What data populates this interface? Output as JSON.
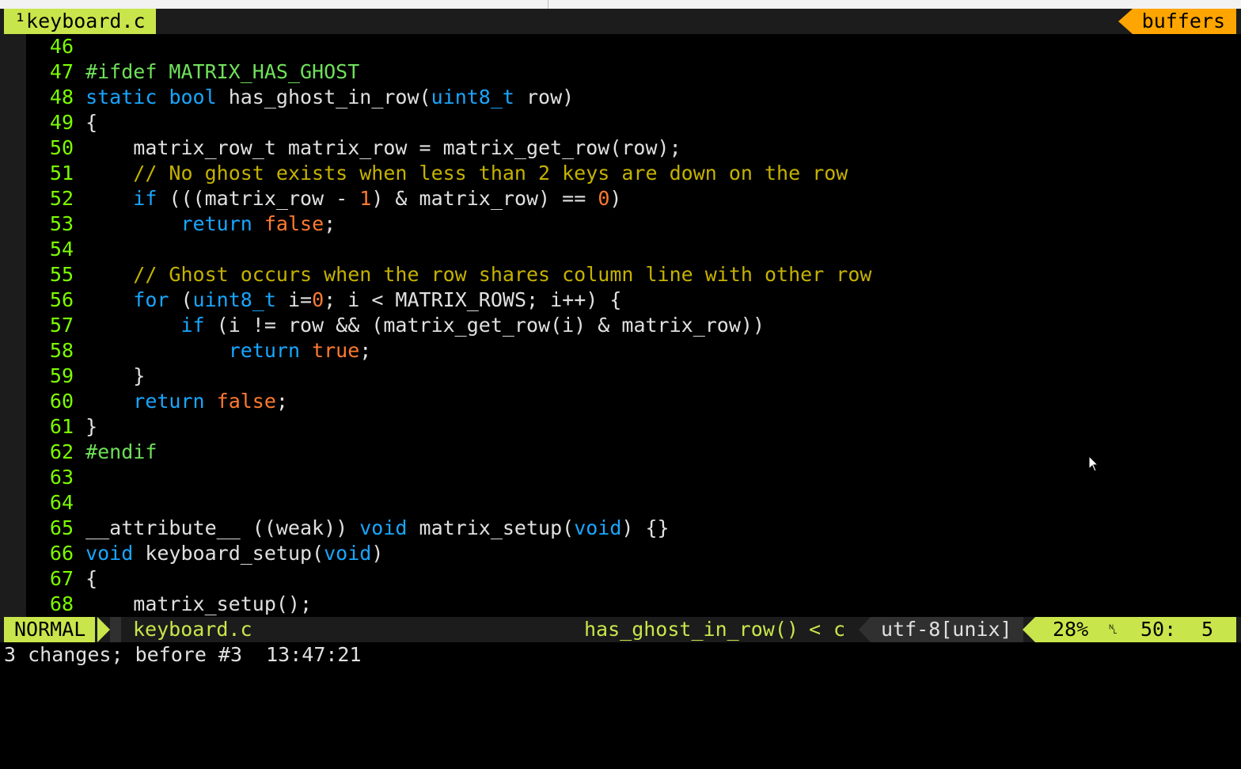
{
  "tabline": {
    "active_tab": "¹keyboard.c",
    "buffers_label": "buffers"
  },
  "lines": [
    {
      "n": "46",
      "tokens": []
    },
    {
      "n": "47",
      "tokens": [
        {
          "t": "#ifdef MATRIX_HAS_GHOST",
          "c": "pp"
        }
      ]
    },
    {
      "n": "48",
      "tokens": [
        {
          "t": "static",
          "c": "kw"
        },
        {
          "t": " "
        },
        {
          "t": "bool",
          "c": "kw"
        },
        {
          "t": " has_ghost_in_row("
        },
        {
          "t": "uint8_t",
          "c": "kw"
        },
        {
          "t": " row)"
        }
      ]
    },
    {
      "n": "49",
      "tokens": [
        {
          "t": "{"
        }
      ]
    },
    {
      "n": "50",
      "tokens": [
        {
          "t": "    matrix_row_t matrix_row = matrix_get_row(row);"
        }
      ]
    },
    {
      "n": "51",
      "tokens": [
        {
          "t": "    "
        },
        {
          "t": "// No ghost exists when less than 2 keys are down on the row",
          "c": "cm"
        }
      ]
    },
    {
      "n": "52",
      "tokens": [
        {
          "t": "    "
        },
        {
          "t": "if",
          "c": "kw"
        },
        {
          "t": " (((matrix_row - "
        },
        {
          "t": "1",
          "c": "num"
        },
        {
          "t": ") & matrix_row) == "
        },
        {
          "t": "0",
          "c": "num"
        },
        {
          "t": ")"
        }
      ]
    },
    {
      "n": "53",
      "tokens": [
        {
          "t": "        "
        },
        {
          "t": "return",
          "c": "kw"
        },
        {
          "t": " "
        },
        {
          "t": "false",
          "c": "bool"
        },
        {
          "t": ";"
        }
      ]
    },
    {
      "n": "54",
      "tokens": []
    },
    {
      "n": "55",
      "tokens": [
        {
          "t": "    "
        },
        {
          "t": "// Ghost occurs when the row shares column line with other row",
          "c": "cm"
        }
      ]
    },
    {
      "n": "56",
      "tokens": [
        {
          "t": "    "
        },
        {
          "t": "for",
          "c": "kw"
        },
        {
          "t": " ("
        },
        {
          "t": "uint8_t",
          "c": "kw"
        },
        {
          "t": " i="
        },
        {
          "t": "0",
          "c": "num"
        },
        {
          "t": "; i < MATRIX_ROWS; i++) {"
        }
      ]
    },
    {
      "n": "57",
      "tokens": [
        {
          "t": "        "
        },
        {
          "t": "if",
          "c": "kw"
        },
        {
          "t": " (i != row && (matrix_get_row(i) & matrix_row))"
        }
      ]
    },
    {
      "n": "58",
      "tokens": [
        {
          "t": "            "
        },
        {
          "t": "return",
          "c": "kw"
        },
        {
          "t": " "
        },
        {
          "t": "true",
          "c": "bool"
        },
        {
          "t": ";"
        }
      ]
    },
    {
      "n": "59",
      "tokens": [
        {
          "t": "    }"
        }
      ]
    },
    {
      "n": "60",
      "tokens": [
        {
          "t": "    "
        },
        {
          "t": "return",
          "c": "kw"
        },
        {
          "t": " "
        },
        {
          "t": "false",
          "c": "bool"
        },
        {
          "t": ";"
        }
      ]
    },
    {
      "n": "61",
      "tokens": [
        {
          "t": "}"
        }
      ]
    },
    {
      "n": "62",
      "tokens": [
        {
          "t": "#endif",
          "c": "pp"
        }
      ]
    },
    {
      "n": "63",
      "tokens": []
    },
    {
      "n": "64",
      "tokens": []
    },
    {
      "n": "65",
      "tokens": [
        {
          "t": "__attribute__ ((weak)) "
        },
        {
          "t": "void",
          "c": "kw"
        },
        {
          "t": " matrix_setup("
        },
        {
          "t": "void",
          "c": "kw"
        },
        {
          "t": ") {}"
        }
      ]
    },
    {
      "n": "66",
      "tokens": [
        {
          "t": "void",
          "c": "kw"
        },
        {
          "t": " keyboard_setup("
        },
        {
          "t": "void",
          "c": "kw"
        },
        {
          "t": ")"
        }
      ]
    },
    {
      "n": "67",
      "tokens": [
        {
          "t": "{"
        }
      ]
    },
    {
      "n": "68",
      "tokens": [
        {
          "t": "    matrix_setup();"
        }
      ]
    }
  ],
  "statusline": {
    "mode": "NORMAL",
    "filename": "keyboard.c",
    "function": "has_ghost_in_row()",
    "separator": "<",
    "filetype": "c",
    "encoding": "utf-8[unix]",
    "percent": "28%",
    "line_symbol": "␤",
    "line": "50:",
    "column": "5"
  },
  "cmdline": "3 changes; before #3  13:47:21",
  "colors": {
    "accent_green": "#c8e64b",
    "buffers_orange": "#ffa500",
    "line_number": "#7cfc00",
    "keyword": "#18a6ff",
    "comment": "#c5b200",
    "number": "#ff7a2f",
    "preprocessor": "#6fe05a"
  }
}
